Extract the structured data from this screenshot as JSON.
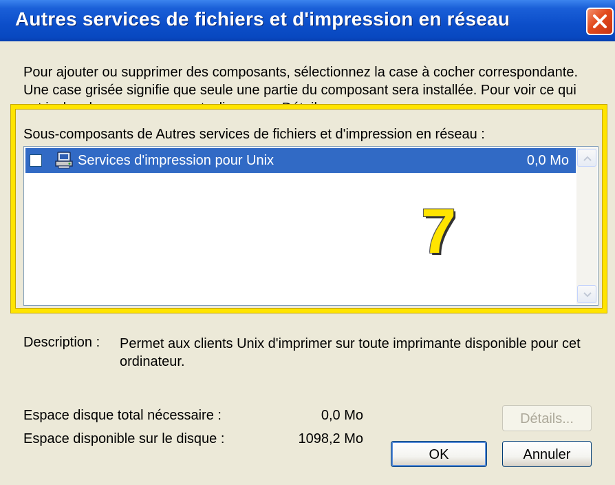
{
  "window": {
    "title": "Autres services de fichiers et d'impression en réseau",
    "close_icon": "close-icon"
  },
  "intro": {
    "text": "Pour ajouter ou supprimer des composants, sélectionnez la case à cocher correspondante. Une case grisée signifie que seule une partie du composant sera installée. Pour voir ce qui est inclus dans un composant, cliquez sur Détails."
  },
  "subcomponents": {
    "label": "Sous-composants de Autres services de fichiers et d'impression en réseau :",
    "items": [
      {
        "label": "Services d'impression pour Unix",
        "size": "0,0 Mo",
        "checked": false,
        "selected": true,
        "icon": "network-printer-icon"
      }
    ]
  },
  "annotation": {
    "number": "7",
    "color": "#ffe400"
  },
  "description": {
    "label": "Description :",
    "text": "Permet aux clients Unix d'imprimer sur toute imprimante disponible pour cet ordinateur."
  },
  "disk": {
    "total_label": "Espace disque total nécessaire :",
    "total_value": "0,0 Mo",
    "available_label": "Espace disponible sur le disque :",
    "available_value": "1098,2 Mo"
  },
  "buttons": {
    "details": "Détails...",
    "ok": "OK",
    "cancel": "Annuler"
  },
  "colors": {
    "titlebar": "#0c4ec9",
    "selection": "#316ac5",
    "dialog_bg": "#ece9d8",
    "highlight_frame": "#ffe400"
  }
}
